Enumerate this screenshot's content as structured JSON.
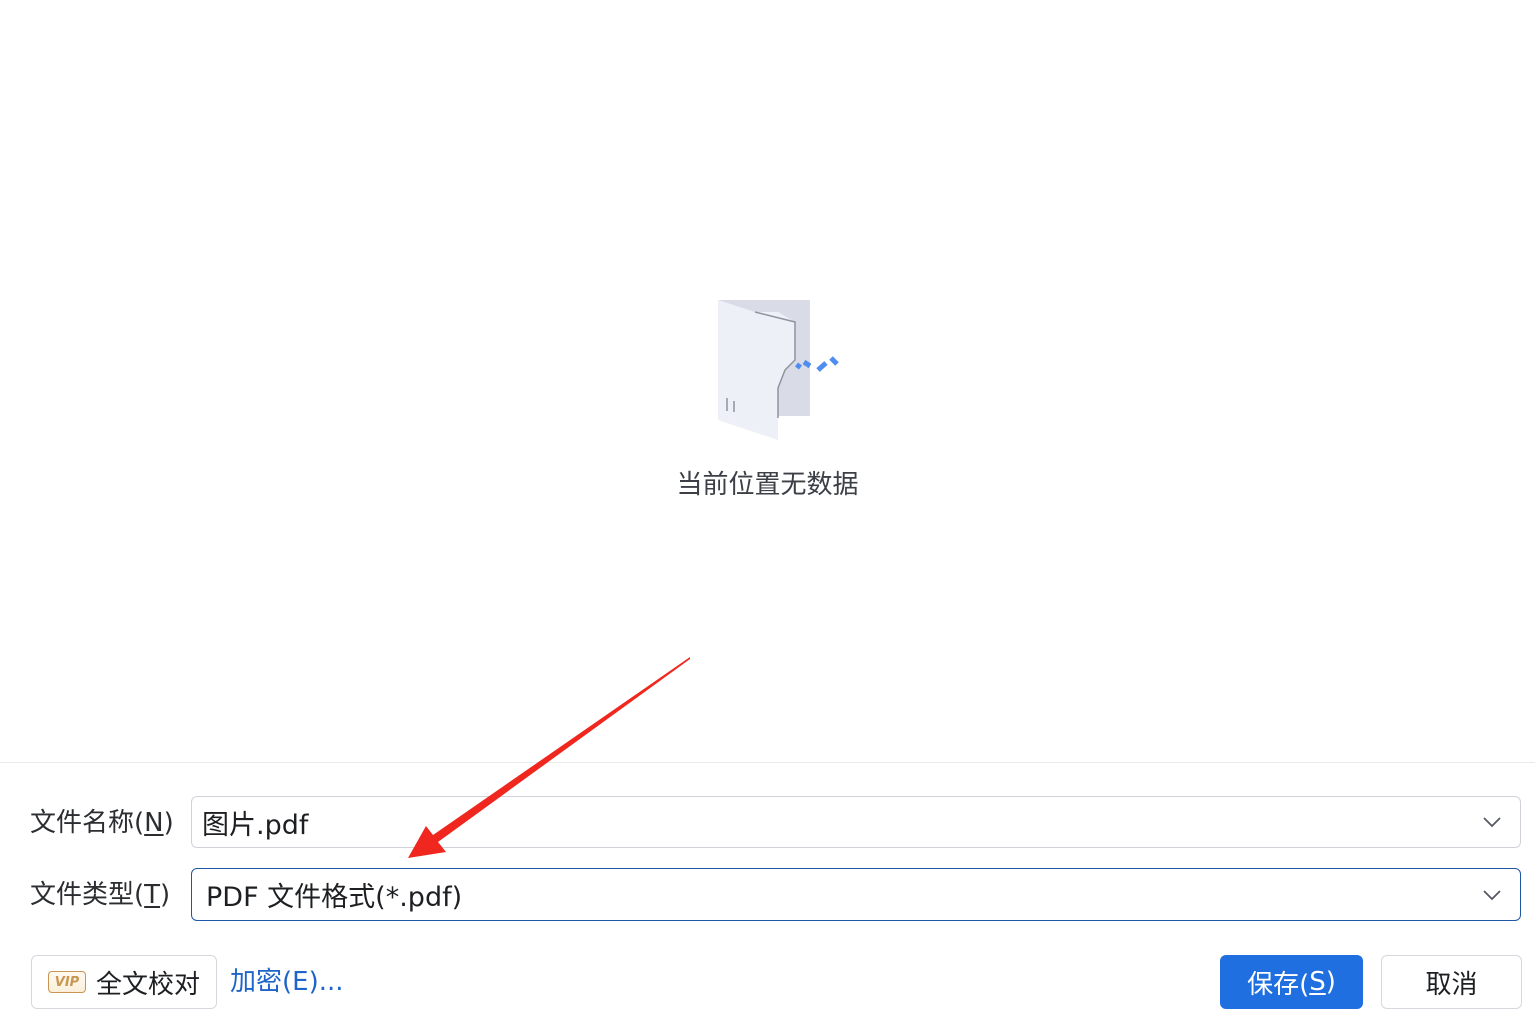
{
  "browser": {
    "empty_message": "当前位置无数据"
  },
  "form": {
    "filename_label": "文件名称(",
    "filename_hotkey": "N",
    "filename_label_end": ")",
    "filename_value": "图片.pdf",
    "filetype_label": "文件类型(",
    "filetype_hotkey": "T",
    "filetype_label_end": ")",
    "filetype_value": "PDF 文件格式(*.pdf)"
  },
  "actions": {
    "vip_badge": "VIP",
    "proofread_label": "全文校对",
    "encrypt_label": "加密(E)...",
    "save_label": "保存(",
    "save_hotkey": "S",
    "save_label_end": ")",
    "cancel_label": "取消"
  },
  "colors": {
    "accent": "#1f6fe0",
    "link": "#1f64c9",
    "annotation_arrow": "#f0271e"
  }
}
